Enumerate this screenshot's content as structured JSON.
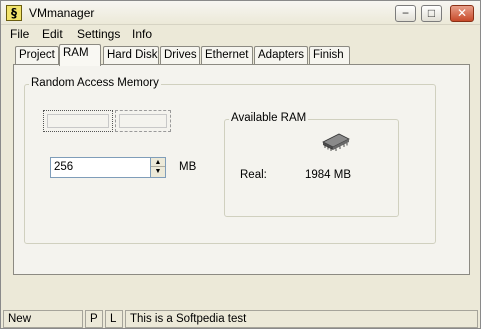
{
  "window": {
    "title": "VMmanager",
    "app_icon_glyph": "§",
    "controls": {
      "minimize": "−",
      "maximize": "□",
      "close": "✕"
    }
  },
  "menu": {
    "items": [
      "File",
      "Edit",
      "Settings",
      "Info"
    ]
  },
  "tabs": [
    {
      "label": "Project",
      "active": false
    },
    {
      "label": "RAM",
      "active": true
    },
    {
      "label": "Hard Disk",
      "active": false
    },
    {
      "label": "Drives",
      "active": false
    },
    {
      "label": "Ethernet",
      "active": false
    },
    {
      "label": "Adapters",
      "active": false
    },
    {
      "label": "Finish",
      "active": false
    }
  ],
  "ram_panel": {
    "group_title": "Random Access Memory",
    "memory_value": "256",
    "memory_unit": "MB",
    "available_group_title": "Available RAM",
    "chip_icon": "memory-chip-icon",
    "real_label": "Real:",
    "real_value": "1984 MB"
  },
  "statusbar": {
    "state": "New",
    "flag_p": "P",
    "flag_l": "L",
    "message": "This is a Softpedia test"
  }
}
